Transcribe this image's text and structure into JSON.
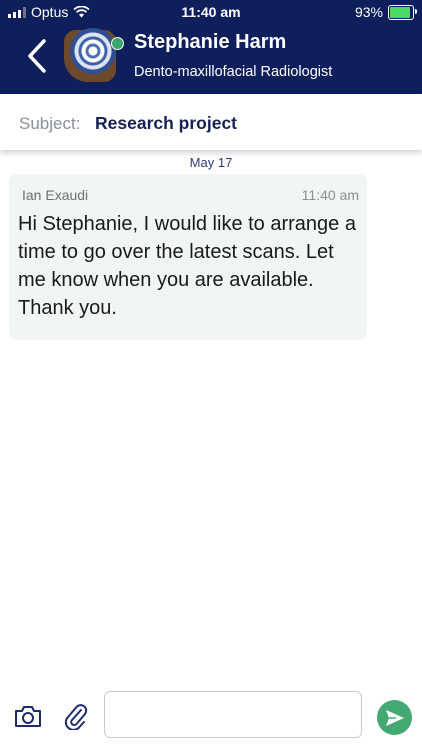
{
  "status_bar": {
    "carrier": "Optus",
    "time": "11:40 am",
    "battery": "93%",
    "battery_level": 0.93
  },
  "header": {
    "back_icon": "chevron-left-icon",
    "contact_name": "Stephanie Harm",
    "contact_role": "Dento-maxillofacial Radiologist",
    "online": true,
    "online_color": "#3aa86a",
    "background_color": "#0f1f5c"
  },
  "subject": {
    "label": "Subject:",
    "value": "Research project"
  },
  "conversation": {
    "date_separator": "May 17",
    "messages": [
      {
        "sender": "Ian Exaudi",
        "time": "11:40 am",
        "text": "Hi Stephanie, I would like to arrange a time to go over the latest scans. Let me know when you are available. Thank you."
      }
    ]
  },
  "composer": {
    "camera_icon": "camera-icon",
    "attach_icon": "paperclip-icon",
    "input_value": "",
    "input_placeholder": "",
    "send_icon": "send-icon",
    "send_color": "#44a873"
  }
}
